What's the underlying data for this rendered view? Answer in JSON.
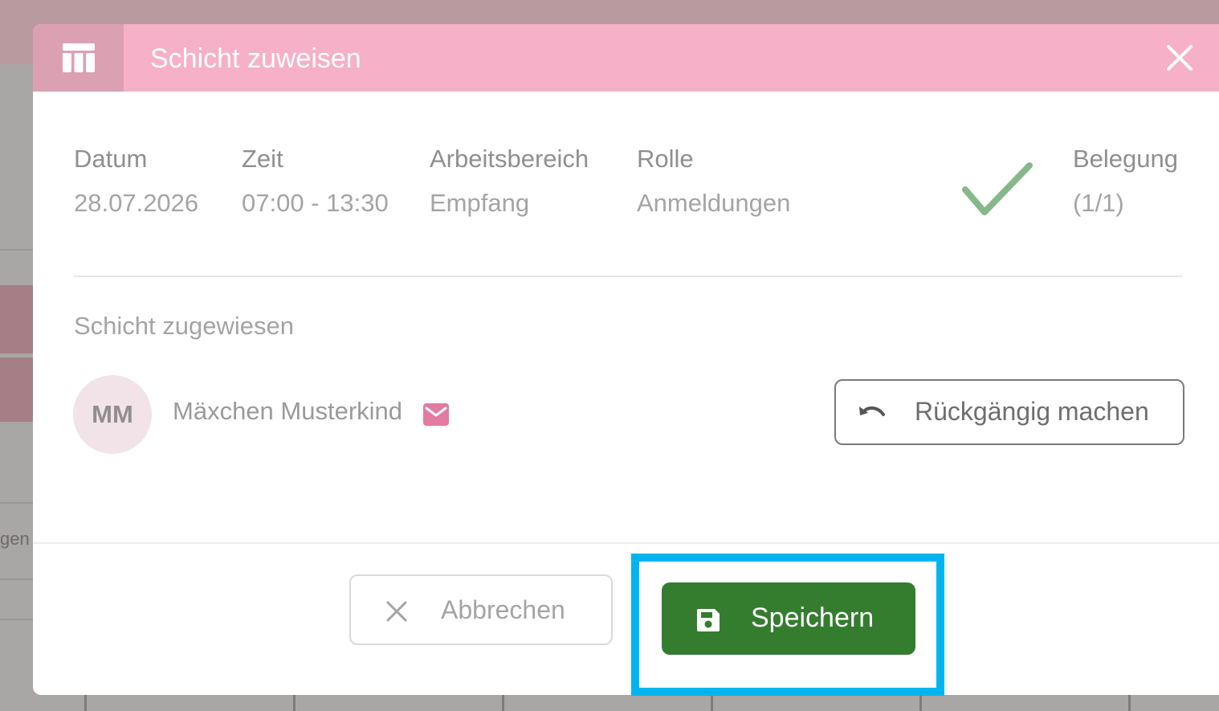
{
  "background": {
    "partial_text": "gen"
  },
  "dialog": {
    "title": "Schicht zuweisen",
    "icon": "calendar-table-icon",
    "close_icon": "close-icon"
  },
  "shift": {
    "date_label": "Datum",
    "date_value": "28.07.2026",
    "time_label": "Zeit",
    "time_value": "07:00 - 13:30",
    "area_label": "Arbeitsbereich",
    "area_value": "Empfang",
    "role_label": "Rolle",
    "role_value": "Anmeldungen",
    "occupancy_label": "Belegung",
    "occupancy_value": "(1/1)",
    "status_icon": "checkmark-icon"
  },
  "assignment": {
    "section_label": "Schicht zugewiesen",
    "avatar_initials": "MM",
    "person_name": "Mäxchen Musterkind",
    "mail_icon": "mail-icon",
    "undo_label": "Rückgängig machen"
  },
  "footer": {
    "cancel_label": "Abbrechen",
    "save_label": "Speichern"
  },
  "colors": {
    "header": "#f6b0c8",
    "header_icon_bg": "#dba1b3",
    "save_button": "#347d2f",
    "highlight": "#00b5ee",
    "check": "#86b88a",
    "mail": "#e27aa1"
  }
}
